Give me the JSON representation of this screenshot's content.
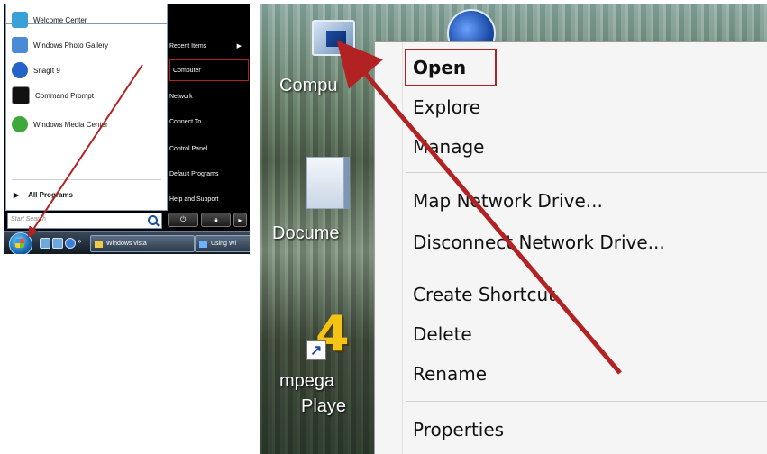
{
  "start_menu": {
    "left_items": [
      {
        "label": "Welcome Center",
        "icon": "welcome-icon",
        "color": "#3aa0d8"
      },
      {
        "label": "Windows Photo Gallery",
        "icon": "photo-gallery-icon",
        "color": "#4b8bd6"
      },
      {
        "label": "SnagIt 9",
        "icon": "snagit-icon",
        "color": "#2563c9"
      },
      {
        "label": "Command Prompt",
        "icon": "command-prompt-icon",
        "color": "#111111"
      },
      {
        "label": "Windows Media Center",
        "icon": "media-center-icon",
        "color": "#3fa83a"
      }
    ],
    "all_programs": "All Programs",
    "search_placeholder": "Start Search",
    "right_items": [
      {
        "label": "Recent Items",
        "submenu": true
      },
      {
        "label": "Computer",
        "highlighted": true
      },
      {
        "label": "Network"
      },
      {
        "label": "Connect To"
      },
      {
        "label": "Control Panel"
      },
      {
        "label": "Default Programs"
      },
      {
        "label": "Help and Support"
      }
    ],
    "taskbar": {
      "overflow": "»",
      "buttons": [
        "Windows vista",
        "Using Wi"
      ]
    }
  },
  "desktop": {
    "icons": [
      {
        "label": "Compu",
        "icon": "computer-icon"
      },
      {
        "label": "Docume",
        "icon": "documents-icon"
      },
      {
        "label_line1": "mpega",
        "label_line2": "Playe",
        "icon": "mpeg4-player-icon"
      }
    ],
    "context_menu": {
      "groups": [
        [
          "Open",
          "Explore",
          "Manage"
        ],
        [
          "Map Network Drive...",
          "Disconnect Network Drive..."
        ],
        [
          "Create Shortcut",
          "Delete",
          "Rename"
        ],
        [
          "Properties"
        ]
      ],
      "highlighted_item": "Open"
    }
  },
  "colors": {
    "annotation_red": "#b22222",
    "taskbar": "#1c2633"
  }
}
